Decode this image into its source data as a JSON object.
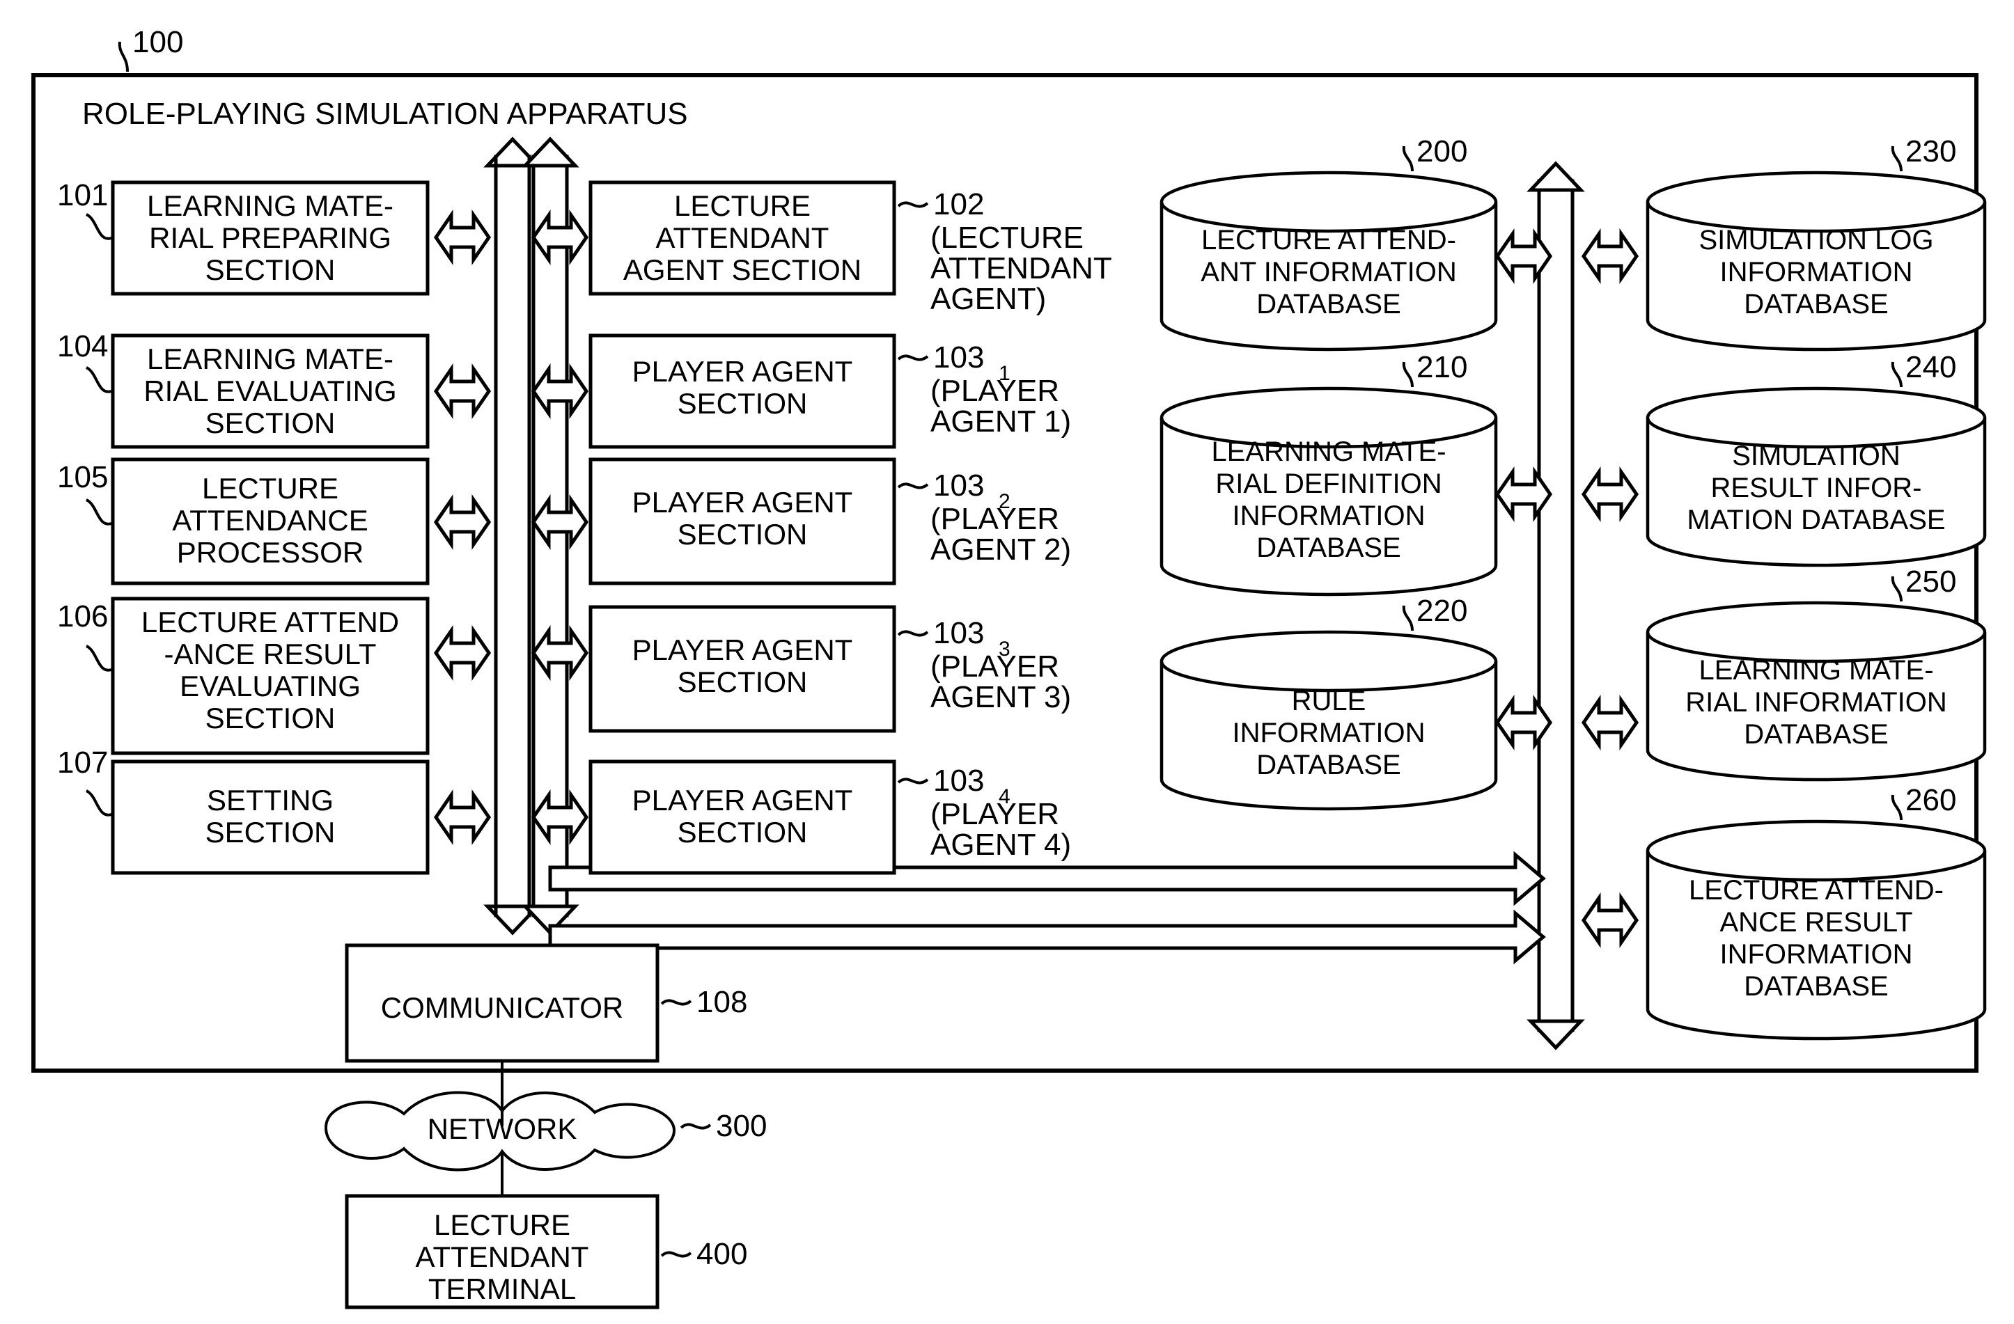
{
  "figure": {
    "apparatus_ref": "100",
    "apparatus_title": "ROLE-PLAYING SIMULATION APPARATUS"
  },
  "left_column": [
    {
      "ref": "101",
      "lines": [
        "LEARNING MATE-",
        "RIAL PREPARING",
        "SECTION"
      ]
    },
    {
      "ref": "104",
      "lines": [
        "LEARNING MATE-",
        "RIAL EVALUATING",
        "SECTION"
      ]
    },
    {
      "ref": "105",
      "lines": [
        "LECTURE",
        "ATTENDANCE",
        "PROCESSOR"
      ]
    },
    {
      "ref": "106",
      "lines": [
        "LECTURE ATTEND",
        "-ANCE RESULT",
        "EVALUATING",
        "SECTION"
      ]
    },
    {
      "ref": "107",
      "lines": [
        "SETTING",
        "SECTION"
      ]
    }
  ],
  "center_column": [
    {
      "ref": "102",
      "sub": "",
      "paren": [
        "(LECTURE",
        "ATTENDANT",
        "AGENT)"
      ],
      "lines": [
        "LECTURE",
        "ATTENDANT",
        "AGENT SECTION"
      ]
    },
    {
      "ref": "103",
      "sub": "1",
      "paren": [
        "(PLAYER",
        "AGENT 1)"
      ],
      "lines": [
        "PLAYER AGENT",
        "SECTION"
      ]
    },
    {
      "ref": "103",
      "sub": "2",
      "paren": [
        "(PLAYER",
        "AGENT 2)"
      ],
      "lines": [
        "PLAYER AGENT",
        "SECTION"
      ]
    },
    {
      "ref": "103",
      "sub": "3",
      "paren": [
        "(PLAYER",
        "AGENT 3)"
      ],
      "lines": [
        "PLAYER AGENT",
        "SECTION"
      ]
    },
    {
      "ref": "103",
      "sub": "4",
      "paren": [
        "(PLAYER",
        "AGENT 4)"
      ],
      "lines": [
        "PLAYER AGENT",
        "SECTION"
      ]
    }
  ],
  "db_column_left": [
    {
      "ref": "200",
      "lines": [
        "LECTURE ATTEND-",
        "ANT INFORMATION",
        "DATABASE"
      ]
    },
    {
      "ref": "210",
      "lines": [
        "LEARNING MATE-",
        "RIAL DEFINITION",
        "INFORMATION",
        "DATABASE"
      ]
    },
    {
      "ref": "220",
      "lines": [
        "RULE",
        "INFORMATION",
        "DATABASE"
      ]
    }
  ],
  "db_column_right": [
    {
      "ref": "230",
      "lines": [
        "SIMULATION LOG",
        "INFORMATION",
        "DATABASE"
      ]
    },
    {
      "ref": "240",
      "lines": [
        "SIMULATION",
        "RESULT INFOR-",
        "MATION DATABASE"
      ]
    },
    {
      "ref": "250",
      "lines": [
        "LEARNING MATE-",
        "RIAL INFORMATION",
        "DATABASE"
      ]
    },
    {
      "ref": "260",
      "lines": [
        "LECTURE ATTEND-",
        "ANCE RESULT",
        "INFORMATION",
        "DATABASE"
      ]
    }
  ],
  "bottom": {
    "communicator": {
      "ref": "108",
      "label": "COMMUNICATOR"
    },
    "network": {
      "ref": "300",
      "label": "NETWORK"
    },
    "terminal": {
      "ref": "400",
      "lines": [
        "LECTURE",
        "ATTENDANT",
        "TERMINAL"
      ]
    }
  }
}
